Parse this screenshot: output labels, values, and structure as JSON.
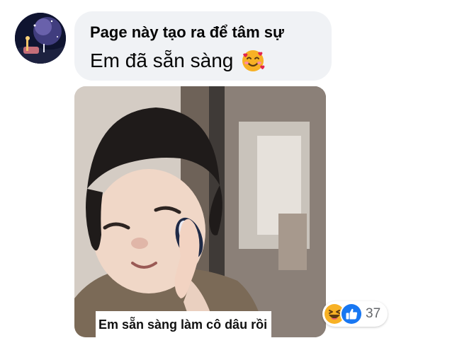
{
  "comment": {
    "author": "Page này tạo ra để tâm sự",
    "text": "Em đã sẵn sàng",
    "emoji": "smiling-face-with-hearts-icon"
  },
  "attachment": {
    "caption": "Em sẵn sàng làm cô dâu rồi"
  },
  "reactions": {
    "icons": [
      "haha-icon",
      "like-icon"
    ],
    "count": "37"
  },
  "colors": {
    "bubble": "#f0f2f5",
    "like": "#1877f2",
    "haha": "#f7b125",
    "count_text": "#65676b"
  }
}
